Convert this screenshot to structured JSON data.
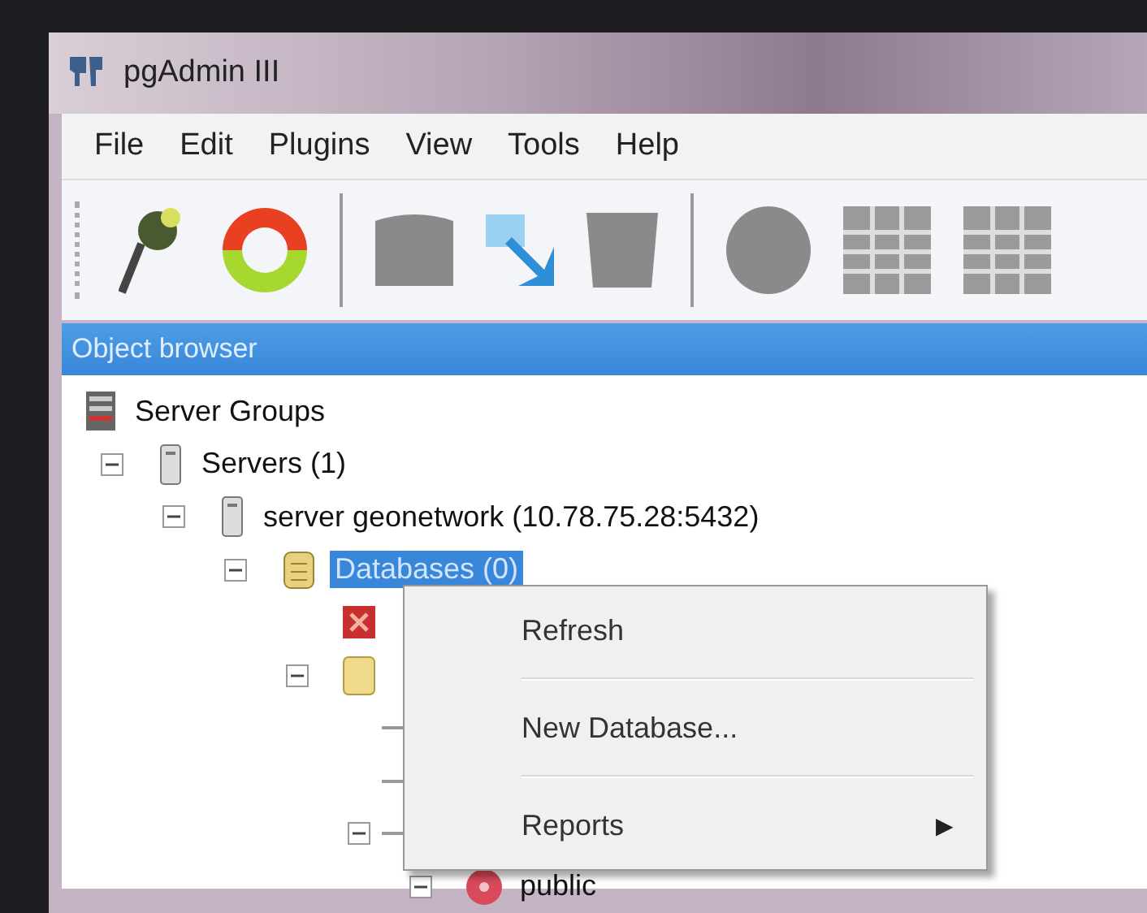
{
  "window": {
    "title": "pgAdmin III"
  },
  "menu": [
    "File",
    "Edit",
    "Plugins",
    "View",
    "Tools",
    "Help"
  ],
  "toolbar": [
    {
      "kind": "plug",
      "disabled": false
    },
    {
      "kind": "refresh",
      "disabled": false
    },
    {
      "kind": "separator"
    },
    {
      "kind": "box",
      "disabled": true
    },
    {
      "kind": "pointer",
      "disabled": false
    },
    {
      "kind": "trash",
      "disabled": true
    },
    {
      "kind": "separator"
    },
    {
      "kind": "circle",
      "disabled": true
    },
    {
      "kind": "grid",
      "disabled": true
    },
    {
      "kind": "grid",
      "disabled": true
    }
  ],
  "panel": {
    "title": "Object browser"
  },
  "tree": [
    {
      "kind": "group",
      "label": "Server Groups",
      "selected": false,
      "children": [
        {
          "kind": "servers",
          "label": "Servers (1)",
          "selected": false,
          "expanded": true,
          "children": [
            {
              "kind": "server",
              "label": "server geonetwork  (10.78.75.28:5432)",
              "selected": false,
              "expanded": true,
              "children": [
                {
                  "kind": "databases",
                  "label": "Databases (0)",
                  "selected": true,
                  "expanded": true,
                  "children": [
                    {
                      "kind": "error"
                    },
                    {
                      "kind": "folder",
                      "expanded": true,
                      "children": [
                        {
                          "kind": "connector"
                        },
                        {
                          "kind": "connector"
                        },
                        {
                          "kind": "connector",
                          "expanded": true,
                          "children": [
                            {
                              "kind": "schema",
                              "label": "public",
                              "selected": false,
                              "expanded": true
                            }
                          ]
                        }
                      ]
                    }
                  ]
                }
              ]
            }
          ]
        }
      ]
    }
  ],
  "context_menu": [
    {
      "kind": "item",
      "label": "Refresh"
    },
    {
      "kind": "item",
      "label": "New Database..."
    },
    {
      "kind": "submenu",
      "label": "Reports",
      "arrow": "▶"
    }
  ]
}
